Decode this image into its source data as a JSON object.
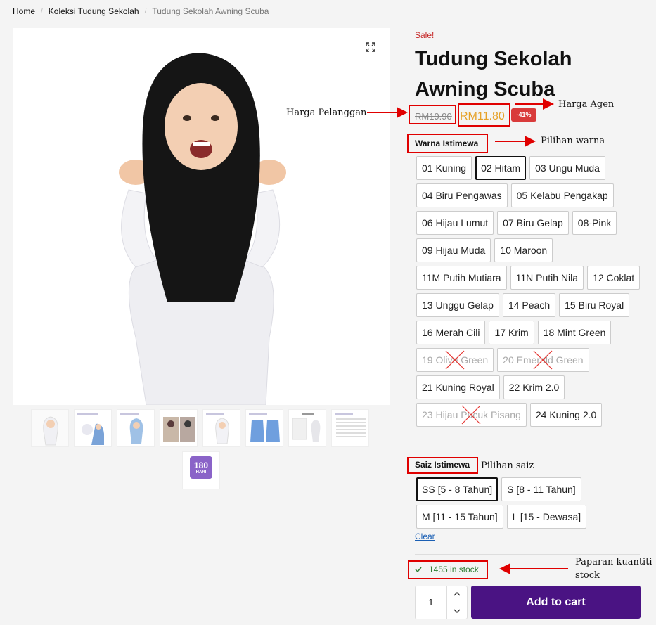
{
  "breadcrumb": {
    "home": "Home",
    "category": "Koleksi Tudung Sekolah",
    "current": "Tudung Sekolah Awning Scuba"
  },
  "product": {
    "sale_label": "Sale!",
    "title": "Tudung Sekolah Awning Scuba",
    "price_old": "RM19.90",
    "price_new": "RM11.80",
    "discount_badge": "-41%"
  },
  "thumbnail_badge": {
    "number": "180",
    "unit": "HARI"
  },
  "color_attribute": {
    "label": "Warna Istimewa",
    "options": [
      {
        "label": "01 Kuning",
        "state": "normal"
      },
      {
        "label": "02 Hitam",
        "state": "selected"
      },
      {
        "label": "03 Ungu Muda",
        "state": "normal"
      },
      {
        "label": "04 Biru Pengawas",
        "state": "normal"
      },
      {
        "label": "05 Kelabu Pengakap",
        "state": "normal"
      },
      {
        "label": "06 Hijau Lumut",
        "state": "normal"
      },
      {
        "label": "07 Biru Gelap",
        "state": "normal"
      },
      {
        "label": "08-Pink",
        "state": "normal"
      },
      {
        "label": "09 Hijau Muda",
        "state": "normal"
      },
      {
        "label": "10 Maroon",
        "state": "normal"
      },
      {
        "label": "11M Putih Mutiara",
        "state": "normal"
      },
      {
        "label": "11N Putih Nila",
        "state": "normal"
      },
      {
        "label": "12 Coklat",
        "state": "normal"
      },
      {
        "label": "13 Unggu Gelap",
        "state": "normal"
      },
      {
        "label": "14 Peach",
        "state": "normal"
      },
      {
        "label": "15 Biru Royal",
        "state": "normal"
      },
      {
        "label": "16 Merah Cili",
        "state": "normal"
      },
      {
        "label": "17 Krim",
        "state": "normal"
      },
      {
        "label": "18 Mint Green",
        "state": "normal"
      },
      {
        "label": "19 Olive Green",
        "state": "disabled"
      },
      {
        "label": "20 Emerald Green",
        "state": "disabled"
      },
      {
        "label": "21 Kuning Royal",
        "state": "normal"
      },
      {
        "label": "22 Krim 2.0",
        "state": "normal"
      },
      {
        "label": "23 Hijau Pucuk Pisang",
        "state": "disabled"
      },
      {
        "label": "24 Kuning 2.0",
        "state": "normal"
      }
    ]
  },
  "size_attribute": {
    "label": "Saiz Istimewa",
    "options": [
      {
        "label": "SS [5 - 8 Tahun]",
        "state": "selected"
      },
      {
        "label": "S [8 - 11 Tahun]",
        "state": "normal"
      },
      {
        "label": "M [11 - 15 Tahun]",
        "state": "normal"
      },
      {
        "label": "L [15 - Dewasa]",
        "state": "normal"
      }
    ]
  },
  "clear_label": "Clear",
  "stock_text": "1455 in stock",
  "quantity": "1",
  "add_to_cart_label": "Add to cart",
  "annotations": {
    "harga_pelanggan": "Harga Pelanggan",
    "harga_agen": "Harga Agen",
    "pilihan_warna": "Pilihan warna",
    "pilihan_saiz": "Pilihan saiz",
    "paparan_line1": "Paparan kuantiti",
    "paparan_line2": "stock"
  },
  "colors": {
    "sale": "#c62828",
    "price_new": "#e6a128",
    "badge": "#d93b3b",
    "button": "#4a1383",
    "stock": "#2e7d32",
    "annotation": "#e00000"
  }
}
